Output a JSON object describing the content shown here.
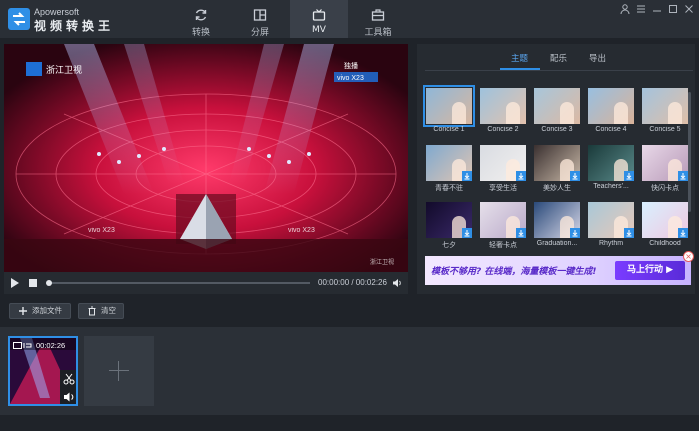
{
  "app": {
    "brand_small": "Apowersoft",
    "brand_name": "视频转换王"
  },
  "nav": {
    "tabs": [
      {
        "label": "转换",
        "icon": "refresh-icon"
      },
      {
        "label": "分屏",
        "icon": "split-screen-icon"
      },
      {
        "label": "MV",
        "icon": "tv-icon",
        "active": true
      },
      {
        "label": "工具箱",
        "icon": "toolbox-icon"
      }
    ]
  },
  "window_controls": [
    "user-icon",
    "menu-icon",
    "minimize-icon",
    "maximize-icon",
    "close-icon"
  ],
  "player": {
    "time": "00:00:00 / 00:02:26",
    "progress": 0.0
  },
  "video_overlay": {
    "channel": "浙江卫视",
    "sponsor": "vivo X23",
    "corner": "独播",
    "watermark": "浙江卫视"
  },
  "panel": {
    "tabs": [
      {
        "label": "主题",
        "active": true
      },
      {
        "label": "配乐"
      },
      {
        "label": "导出"
      }
    ],
    "themes": [
      {
        "label": "Concise 1",
        "selected": true,
        "download": false
      },
      {
        "label": "Concise 2",
        "download": false
      },
      {
        "label": "Concise 3",
        "download": false
      },
      {
        "label": "Concise 4",
        "download": false
      },
      {
        "label": "Concise 5",
        "download": false
      },
      {
        "label": "青春不驻",
        "download": true
      },
      {
        "label": "享受生活",
        "download": true
      },
      {
        "label": "美妙人生",
        "download": true
      },
      {
        "label": "Teachers'...",
        "download": true
      },
      {
        "label": "快闪卡点",
        "download": true
      },
      {
        "label": "七夕",
        "download": true
      },
      {
        "label": "轻奢卡点",
        "download": true
      },
      {
        "label": "Graduation...",
        "download": true
      },
      {
        "label": "Rhythm",
        "download": true
      },
      {
        "label": "Childhood",
        "download": true
      }
    ],
    "banner_text": "模板不够用? 在线端，海量模板一键生成!",
    "banner_button": "马上行动 ▶"
  },
  "toolbar": {
    "add_file": "添加文件",
    "clear": "清空"
  },
  "timeline": {
    "clip_duration": "00:02:26"
  },
  "colors": {
    "accent": "#2f8fe6",
    "background": "#1f2329"
  }
}
